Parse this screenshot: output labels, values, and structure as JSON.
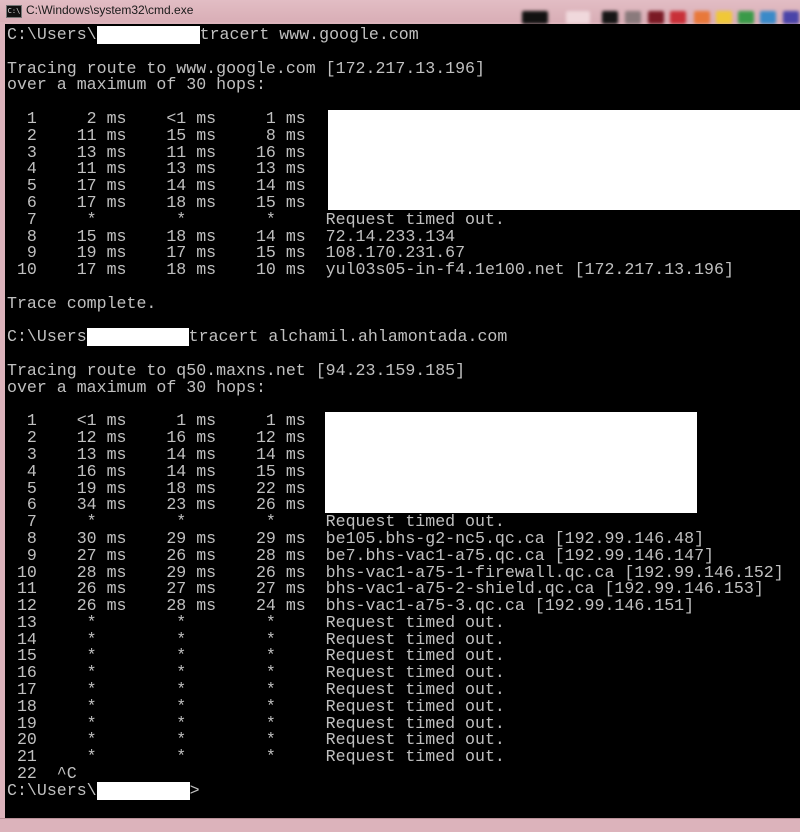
{
  "window": {
    "title": "C:\\Windows\\system32\\cmd.exe",
    "icon": "cmd-icon",
    "icon_text": "C:\\"
  },
  "colors": {
    "terminal_bg": "#000000",
    "terminal_fg": "#c0c0c0",
    "redaction": "#ffffff"
  },
  "terminal": {
    "lines": [
      {
        "prefix": "C:\\Users\\",
        "redacted": true,
        "suffix": "tracert www.google.com"
      },
      {
        "text": ""
      },
      {
        "text": "Tracing route to www.google.com [172.217.13.196]"
      },
      {
        "text": "over a maximum of 30 hops:"
      },
      {
        "text": ""
      },
      {
        "text": "  1     2 ms    <1 ms     1 ms  "
      },
      {
        "text": "  2    11 ms    15 ms     8 ms  "
      },
      {
        "text": "  3    13 ms    11 ms    16 ms  "
      },
      {
        "text": "  4    11 ms    13 ms    13 ms  "
      },
      {
        "text": "  5    17 ms    14 ms    14 ms  "
      },
      {
        "text": "  6    17 ms    18 ms    15 ms  "
      },
      {
        "text": "  7     *        *        *     Request timed out."
      },
      {
        "text": "  8    15 ms    18 ms    14 ms  72.14.233.134"
      },
      {
        "text": "  9    19 ms    17 ms    15 ms  108.170.231.67"
      },
      {
        "text": " 10    17 ms    18 ms    10 ms  yul03s05-in-f4.1e100.net [172.217.13.196]"
      },
      {
        "text": ""
      },
      {
        "text": "Trace complete."
      },
      {
        "text": ""
      },
      {
        "prefix": "C:\\Users",
        "redacted": true,
        "suffix": "tracert alchamil.ahlamontada.com"
      },
      {
        "text": ""
      },
      {
        "text": "Tracing route to q50.maxns.net [94.23.159.185]"
      },
      {
        "text": "over a maximum of 30 hops:"
      },
      {
        "text": ""
      },
      {
        "text": "  1    <1 ms     1 ms     1 ms  "
      },
      {
        "text": "  2    12 ms    16 ms    12 ms  "
      },
      {
        "text": "  3    13 ms    14 ms    14 ms  "
      },
      {
        "text": "  4    16 ms    14 ms    15 ms  "
      },
      {
        "text": "  5    19 ms    18 ms    22 ms  "
      },
      {
        "text": "  6    34 ms    23 ms    26 ms  "
      },
      {
        "text": "  7     *        *        *     Request timed out."
      },
      {
        "text": "  8    30 ms    29 ms    29 ms  be105.bhs-g2-nc5.qc.ca [192.99.146.48]"
      },
      {
        "text": "  9    27 ms    26 ms    28 ms  be7.bhs-vac1-a75.qc.ca [192.99.146.147]"
      },
      {
        "text": " 10    28 ms    29 ms    26 ms  bhs-vac1-a75-1-firewall.qc.ca [192.99.146.152]"
      },
      {
        "text": " 11    26 ms    27 ms    27 ms  bhs-vac1-a75-2-shield.qc.ca [192.99.146.153]"
      },
      {
        "text": " 12    26 ms    28 ms    24 ms  bhs-vac1-a75-3.qc.ca [192.99.146.151]"
      },
      {
        "text": " 13     *        *        *     Request timed out."
      },
      {
        "text": " 14     *        *        *     Request timed out."
      },
      {
        "text": " 15     *        *        *     Request timed out."
      },
      {
        "text": " 16     *        *        *     Request timed out."
      },
      {
        "text": " 17     *        *        *     Request timed out."
      },
      {
        "text": " 18     *        *        *     Request timed out."
      },
      {
        "text": " 19     *        *        *     Request timed out."
      },
      {
        "text": " 20     *        *        *     Request timed out."
      },
      {
        "text": " 21     *        *        *     Request timed out."
      },
      {
        "text": " 22  ^C"
      },
      {
        "prefix": "C:\\Users\\",
        "redacted": true,
        "suffix": ">"
      }
    ]
  }
}
